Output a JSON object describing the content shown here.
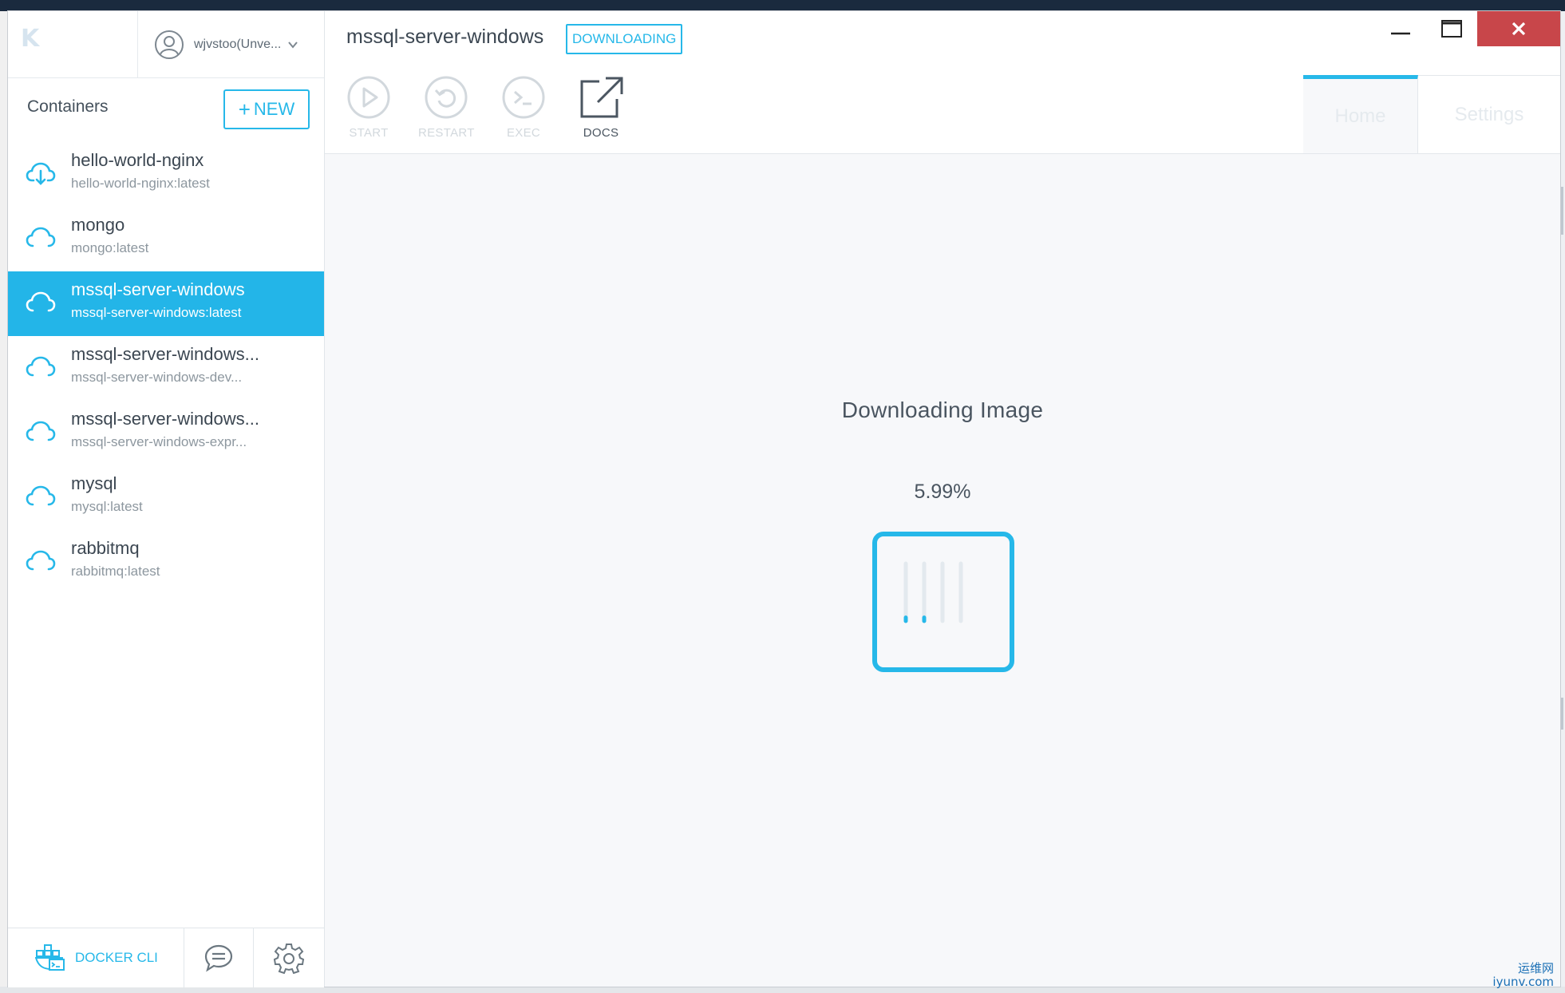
{
  "window": {
    "controls": {
      "minimize": "minimize",
      "maximize": "maximize",
      "close": "close"
    }
  },
  "sidebar": {
    "logo": "K",
    "user_label": "wjvstoo(Unve...",
    "containers_title": "Containers",
    "new_button": {
      "icon": "+",
      "label": "NEW"
    },
    "containers": [
      {
        "name": "hello-world-nginx",
        "image": "hello-world-nginx:latest",
        "icon": "cloud-download-icon",
        "active": false
      },
      {
        "name": "mongo",
        "image": "mongo:latest",
        "icon": "cloud-icon",
        "active": false
      },
      {
        "name": "mssql-server-windows",
        "image": "mssql-server-windows:latest",
        "icon": "cloud-icon",
        "active": true
      },
      {
        "name": "mssql-server-windows...",
        "image": "mssql-server-windows-dev...",
        "icon": "cloud-icon",
        "active": false
      },
      {
        "name": "mssql-server-windows...",
        "image": "mssql-server-windows-expr...",
        "icon": "cloud-icon",
        "active": false
      },
      {
        "name": "mysql",
        "image": "mysql:latest",
        "icon": "cloud-icon",
        "active": false
      },
      {
        "name": "rabbitmq",
        "image": "rabbitmq:latest",
        "icon": "cloud-icon",
        "active": false
      }
    ],
    "footer": {
      "docker_cli_label": "DOCKER CLI"
    }
  },
  "header": {
    "container_title": "mssql-server-windows",
    "status_badge": "DOWNLOADING",
    "actions": [
      {
        "label": "START",
        "icon": "play-icon",
        "enabled": false
      },
      {
        "label": "RESTART",
        "icon": "restart-icon",
        "enabled": false
      },
      {
        "label": "EXEC",
        "icon": "terminal-icon",
        "enabled": false
      },
      {
        "label": "DOCS",
        "icon": "external-link-icon",
        "enabled": true
      }
    ],
    "tabs": [
      {
        "label": "Home",
        "active": true
      },
      {
        "label": "Settings",
        "active": false
      }
    ]
  },
  "download": {
    "title": "Downloading Image",
    "progress_text": "5.99%",
    "progress_fraction": 0.0599
  },
  "colors": {
    "accent": "#26b8e9",
    "active_row": "#23b5e8",
    "close_button": "#c8464a",
    "text_dark": "#3c4752",
    "text_muted": "#8d979f",
    "disabled": "#d2d8dd"
  },
  "watermark": {
    "line1": "运维网",
    "line2": "iyunv.com"
  }
}
